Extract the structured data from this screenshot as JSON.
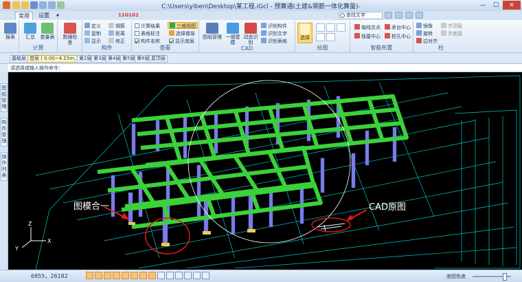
{
  "window": {
    "title": "C:\\Users\\yiben\\Desktop\\某工程.iGcl - 预算通(土建&钢筋一体化算量)-",
    "code_badge": "11G101"
  },
  "menu_tabs": [
    "常用",
    "设置"
  ],
  "search": {
    "placeholder": "查找文字"
  },
  "ribbon": {
    "groups": {
      "calc": "计算",
      "component": "构件",
      "view": "查看",
      "cad": "CAD",
      "draw": "绘图",
      "smart": "智能布置",
      "column": "柱"
    },
    "report": "报表",
    "summary": "汇总",
    "quantity_table": "查量表",
    "data_check": "数据检查",
    "comp_items": [
      "定义",
      "复制",
      "显示",
      "钢筋",
      "距离",
      "修正"
    ],
    "view_items": [
      "计算结果",
      "表格标注",
      "构件名称",
      "三维视图",
      "选择楼层",
      "显示底层"
    ],
    "view_checks": [
      false,
      false,
      true
    ],
    "drawing_manage": "图纸管理",
    "one_click": "一键建模",
    "dynamic_recog": "动态识别",
    "recog_items": [
      "识别构件",
      "识别文字",
      "识别表格"
    ],
    "select": "选择",
    "smart_items": [
      "轴线交点",
      "承台中心",
      "独基中心",
      "桩孔中心",
      "边对齐"
    ],
    "column_items": [
      "镜像",
      "旋转",
      "齐顶层",
      "齐底层"
    ]
  },
  "floors": [
    "基础层",
    "首层 ( 0.00~4.15m,1 )",
    "第2层",
    "第3层",
    "第4层",
    "第5层",
    "第6层",
    "屋顶层"
  ],
  "active_floor_index": 1,
  "command_prompt": "请选择或输入操作命令：",
  "side_tabs": [
    "图纸管理",
    "构件管理",
    "操作列表"
  ],
  "annotations": {
    "left": "图模合一",
    "right": "CAD原图"
  },
  "axis_labels": [
    "Z",
    "X",
    "Y"
  ],
  "status": {
    "coords": "6855，26182",
    "bg_color": "底图色度"
  },
  "colors": {
    "beam": "#3bd13b",
    "column": "#7a7ee8",
    "cad_line": "#00c8c8",
    "annotation": "#e01a1a",
    "highlight_circle": "#ffffff"
  }
}
